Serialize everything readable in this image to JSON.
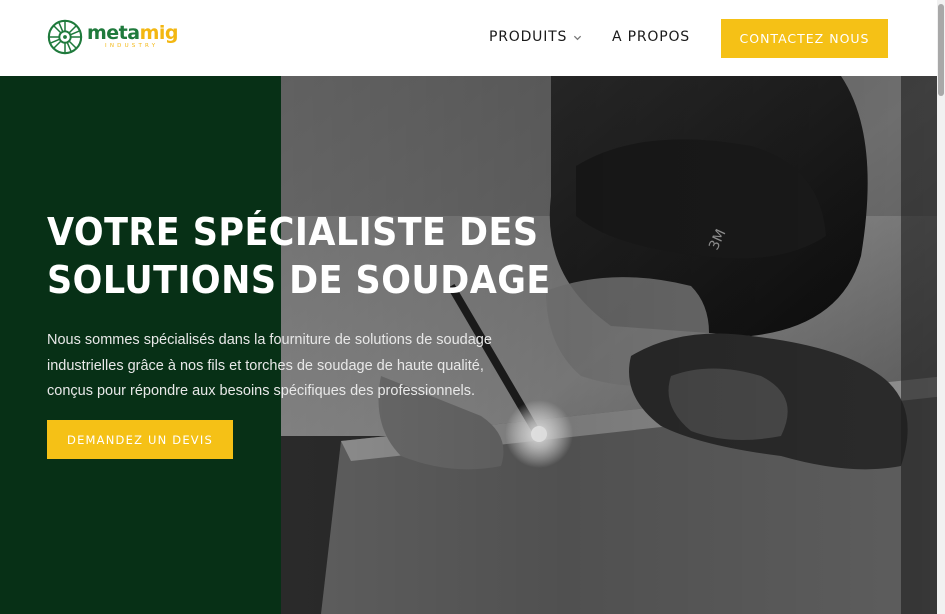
{
  "brand": {
    "name_part1": "meta",
    "name_part2": "mig",
    "tagline": "INDUSTRY",
    "primary_color": "#1f7a3c",
    "accent_color": "#f5c116"
  },
  "nav": {
    "items": [
      {
        "label": "PRODUITS",
        "icon": "chevron-down-icon"
      },
      {
        "label": "A PROPOS"
      }
    ],
    "cta_label": "CONTACTEZ NOUS"
  },
  "hero": {
    "title_lines": [
      "VOTRE SPÉCIALISTE DES",
      "SOLUTIONS DE SOUDAGE"
    ],
    "description_lines": [
      "Nous sommes spécialisés dans la fourniture de solutions de soudage",
      "industrielles grâce à nos fils et torches de soudage de haute qualité,",
      "conçus pour répondre aux besoins spécifiques des professionnels."
    ],
    "cta_label": "DEMANDEZ UN DEVIS",
    "panel_color": "#073016",
    "image": "welder-photo"
  }
}
